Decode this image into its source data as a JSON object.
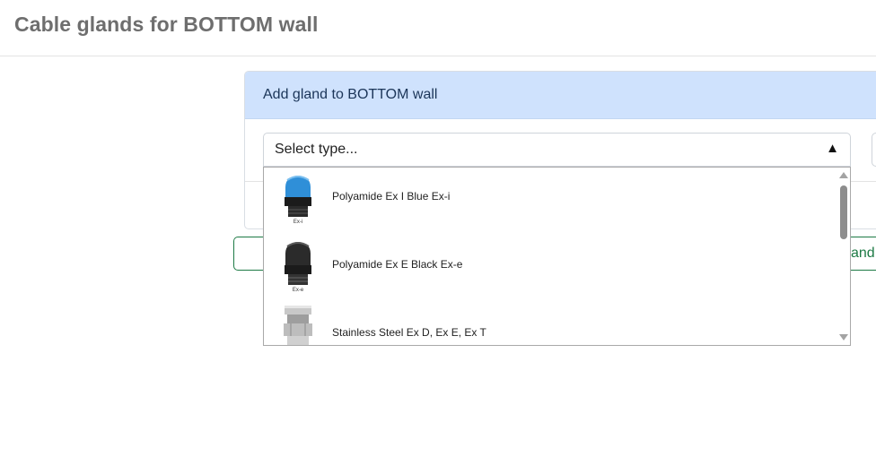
{
  "page": {
    "title": "Cable glands for BOTTOM wall"
  },
  "card": {
    "header_title": "Add gland to BOTTOM wall"
  },
  "select": {
    "value": "Select type...",
    "arrow_icon": "triangle-up-icon",
    "options": [
      {
        "label": "Polyamide Ex I Blue Ex-i",
        "image_caption": "Ex-i",
        "color": "#2f8fd8"
      },
      {
        "label": "Polyamide Ex E Black Ex-e",
        "image_caption": "Ex-e",
        "color": "#2b2b2b"
      },
      {
        "label": "Stainless Steel Ex D, Ex E, Ex T",
        "image_caption": "",
        "color": "#b9b9b9"
      }
    ]
  },
  "add_button": {
    "label_partial": "and ("
  },
  "colors": {
    "header_bg": "#cfe2fd",
    "accent_green": "#1d7a45",
    "title_gray": "#6e6e6e"
  }
}
